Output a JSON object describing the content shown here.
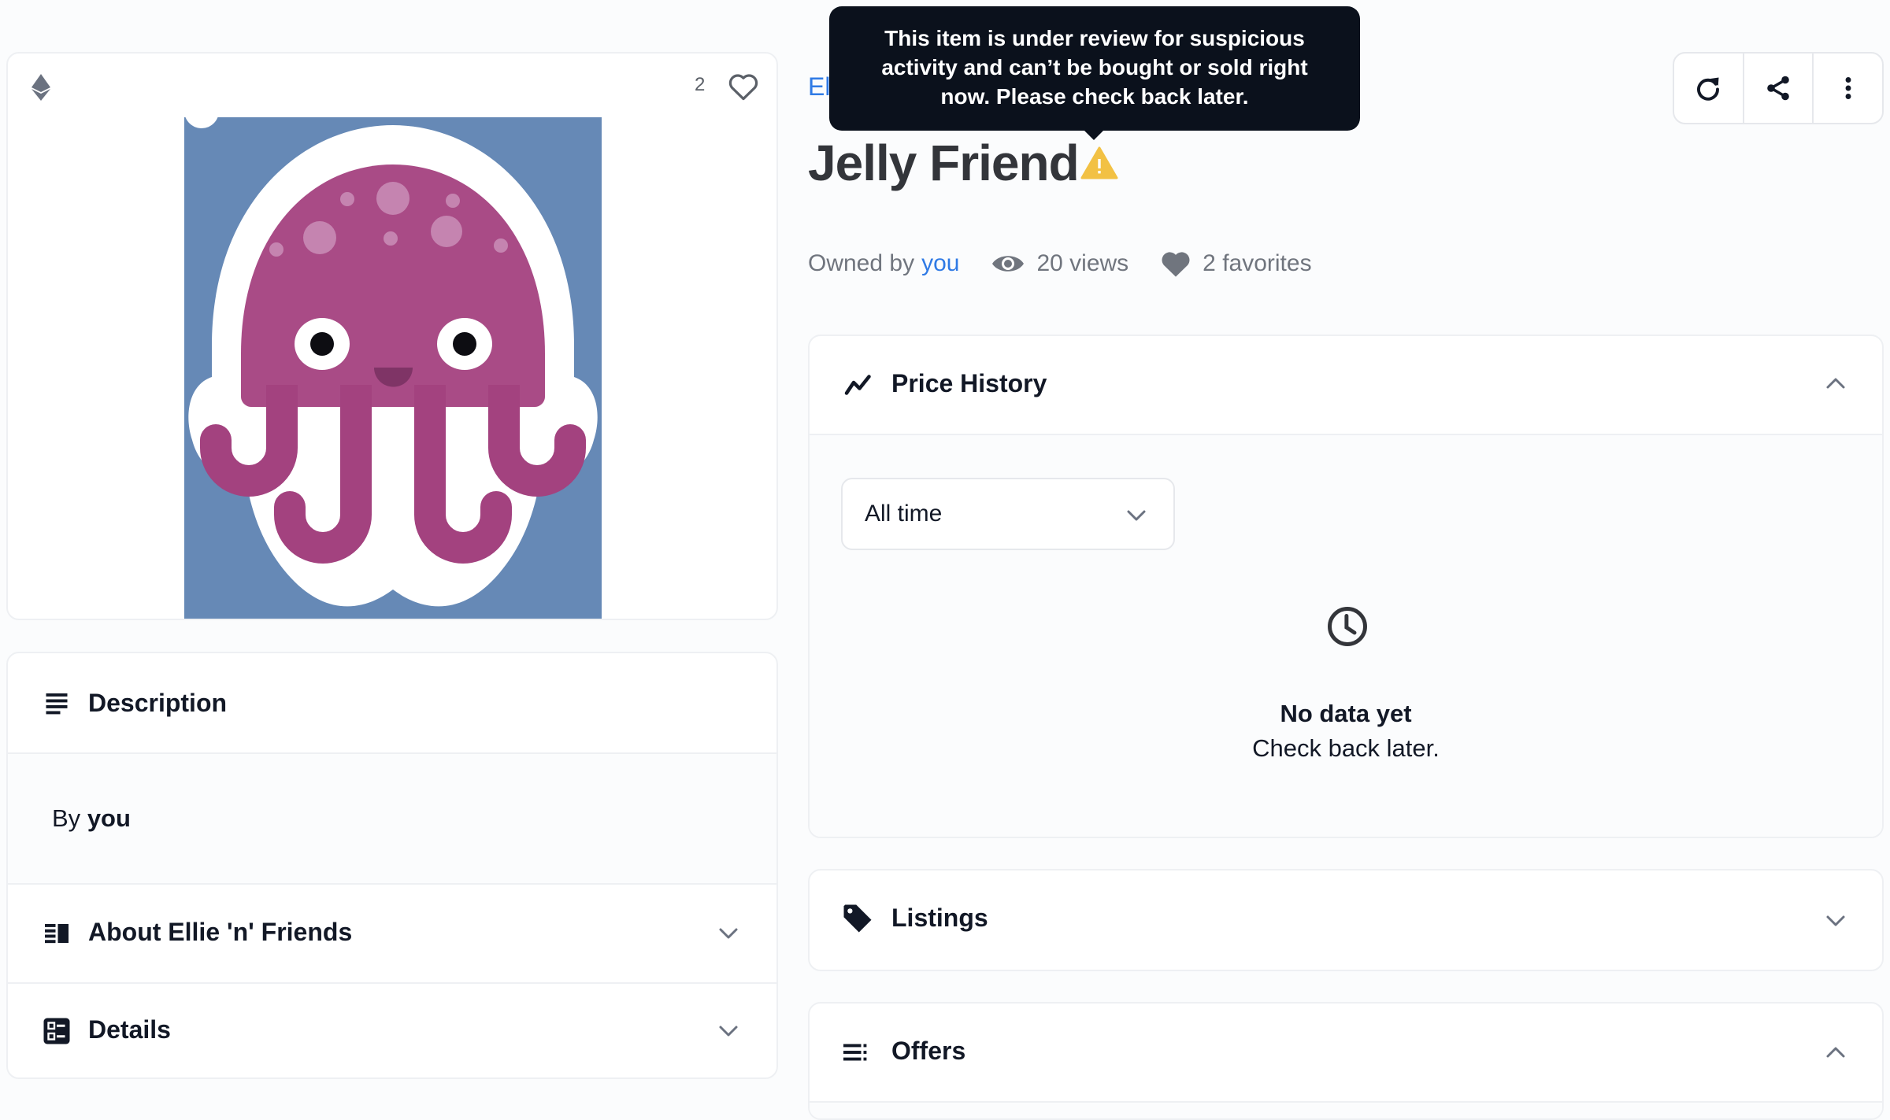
{
  "media": {
    "chain_icon": "ethereum-icon",
    "favorite_count": "2",
    "favorite_icon": "heart-outline-icon",
    "image_alt": "Jelly Friend jellyfish artwork",
    "colors": {
      "background": "#6689b6",
      "body": "#a94b86",
      "spots": "#c584b0",
      "outline": "#ffffff"
    }
  },
  "left_panels": {
    "description": {
      "title": "Description",
      "icon": "text-align-left-icon",
      "by_label": "By",
      "by_value": "you"
    },
    "about": {
      "title": "About Ellie 'n' Friends",
      "icon": "vertical-split-icon",
      "expanded": false
    },
    "details": {
      "title": "Details",
      "icon": "ballot-icon",
      "expanded": false
    }
  },
  "header": {
    "collection_name": "Ellie 'n' Friends",
    "item_title": "Jelly Friend",
    "warning_icon": "warning-triangle-icon",
    "tooltip": "This item is under review for suspicious activity and can’t be bought or sold right now. Please check back later.",
    "actions": [
      {
        "name": "refresh",
        "icon": "refresh-icon"
      },
      {
        "name": "share",
        "icon": "share-icon"
      },
      {
        "name": "more",
        "icon": "more-vertical-icon"
      }
    ]
  },
  "stats": {
    "owned_by_label": "Owned by",
    "owner": "you",
    "views": "20 views",
    "favorites": "2 favorites"
  },
  "price_history": {
    "title": "Price History",
    "expanded": true,
    "range_selected": "All time",
    "empty_title": "No data yet",
    "empty_subtitle": "Check back later."
  },
  "listings": {
    "title": "Listings",
    "expanded": false
  },
  "offers": {
    "title": "Offers",
    "expanded": true
  },
  "colors": {
    "accent": "#2f7ae5",
    "warning": "#f2c144",
    "tooltip_bg": "#0b111c",
    "muted_text": "#70757e"
  }
}
